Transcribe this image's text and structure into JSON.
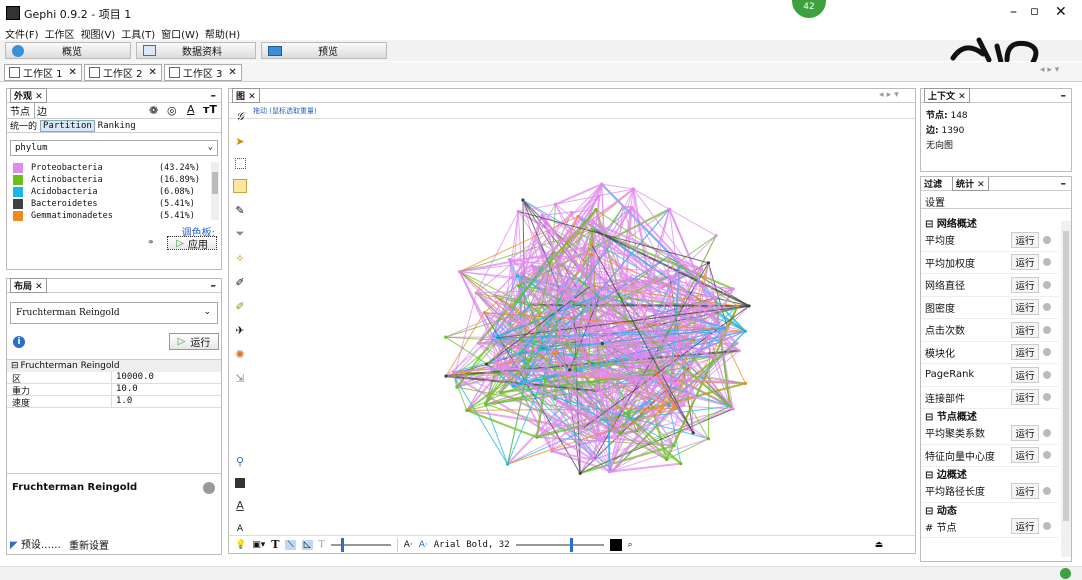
{
  "window": {
    "title": "Gephi 0.9.2 - 项目 1",
    "badge": "42"
  },
  "menu": [
    "文件(F)",
    "工作区",
    "视图(V)",
    "工具(T)",
    "窗口(W)",
    "帮助(H)"
  ],
  "modes": [
    "概览",
    "数据资料",
    "预览"
  ],
  "workspaces": [
    "工作区 1",
    "工作区 2",
    "工作区 3"
  ],
  "appearance": {
    "panel_title": "外观",
    "tabs": [
      "节点",
      "边"
    ],
    "modes": [
      "统一的",
      "Partition",
      "Ranking"
    ],
    "attribute": "phylum",
    "palette": [
      {
        "name": "Proteobacteria",
        "pct": "(43.24%)",
        "color": "#e08aec"
      },
      {
        "name": "Actinobacteria",
        "pct": "(16.89%)",
        "color": "#6abf1f"
      },
      {
        "name": "Acidobacteria",
        "pct": "(6.08%)",
        "color": "#17b7e6"
      },
      {
        "name": "Bacteroidetes",
        "pct": "(5.41%)",
        "color": "#404040"
      },
      {
        "name": "Gemmatimonadetes",
        "pct": "(5.41%)",
        "color": "#f28a1b"
      }
    ],
    "palette_link": "调色板:",
    "apply": "应用"
  },
  "layout": {
    "panel_title": "布局",
    "algorithm": "Fruchterman Reingold",
    "run": "运行",
    "section": "Fruchterman Reingold",
    "props": [
      {
        "k": "区",
        "v": "10000.0"
      },
      {
        "k": "重力",
        "v": "10.0"
      },
      {
        "k": "速度",
        "v": "1.0"
      }
    ],
    "footer_title": "Fruchterman Reingold",
    "presets": "预设……",
    "reset": "重新设置"
  },
  "graph": {
    "tab": "图",
    "drag_hint": "拖动 (鼠标选取重量)",
    "bottom_font": "Arial Bold, 32",
    "bottom_a1": "A·",
    "bottom_a2": "A·"
  },
  "context": {
    "panel_title": "上下文",
    "nodes_label": "节点:",
    "nodes_value": "148",
    "edges_label": "边:",
    "edges_value": "1390",
    "graph_type": "无向图"
  },
  "stats": {
    "tabs": [
      "过滤",
      "统计"
    ],
    "settings": "设置",
    "run_label": "运行",
    "sections": [
      {
        "title": "网络概述",
        "items": [
          "平均度",
          "平均加权度",
          "网络直径",
          "图密度",
          "点击次数",
          "模块化",
          "PageRank",
          "连接部件"
        ]
      },
      {
        "title": "节点概述",
        "items": [
          "平均聚类系数",
          "特征向量中心度"
        ]
      },
      {
        "title": "边概述",
        "items": [
          "平均路径长度"
        ]
      },
      {
        "title": "动态",
        "items": [
          "# 节点"
        ]
      }
    ]
  },
  "colors": {
    "accent": "#2a6fc9",
    "green_badge": "#3da13d"
  }
}
